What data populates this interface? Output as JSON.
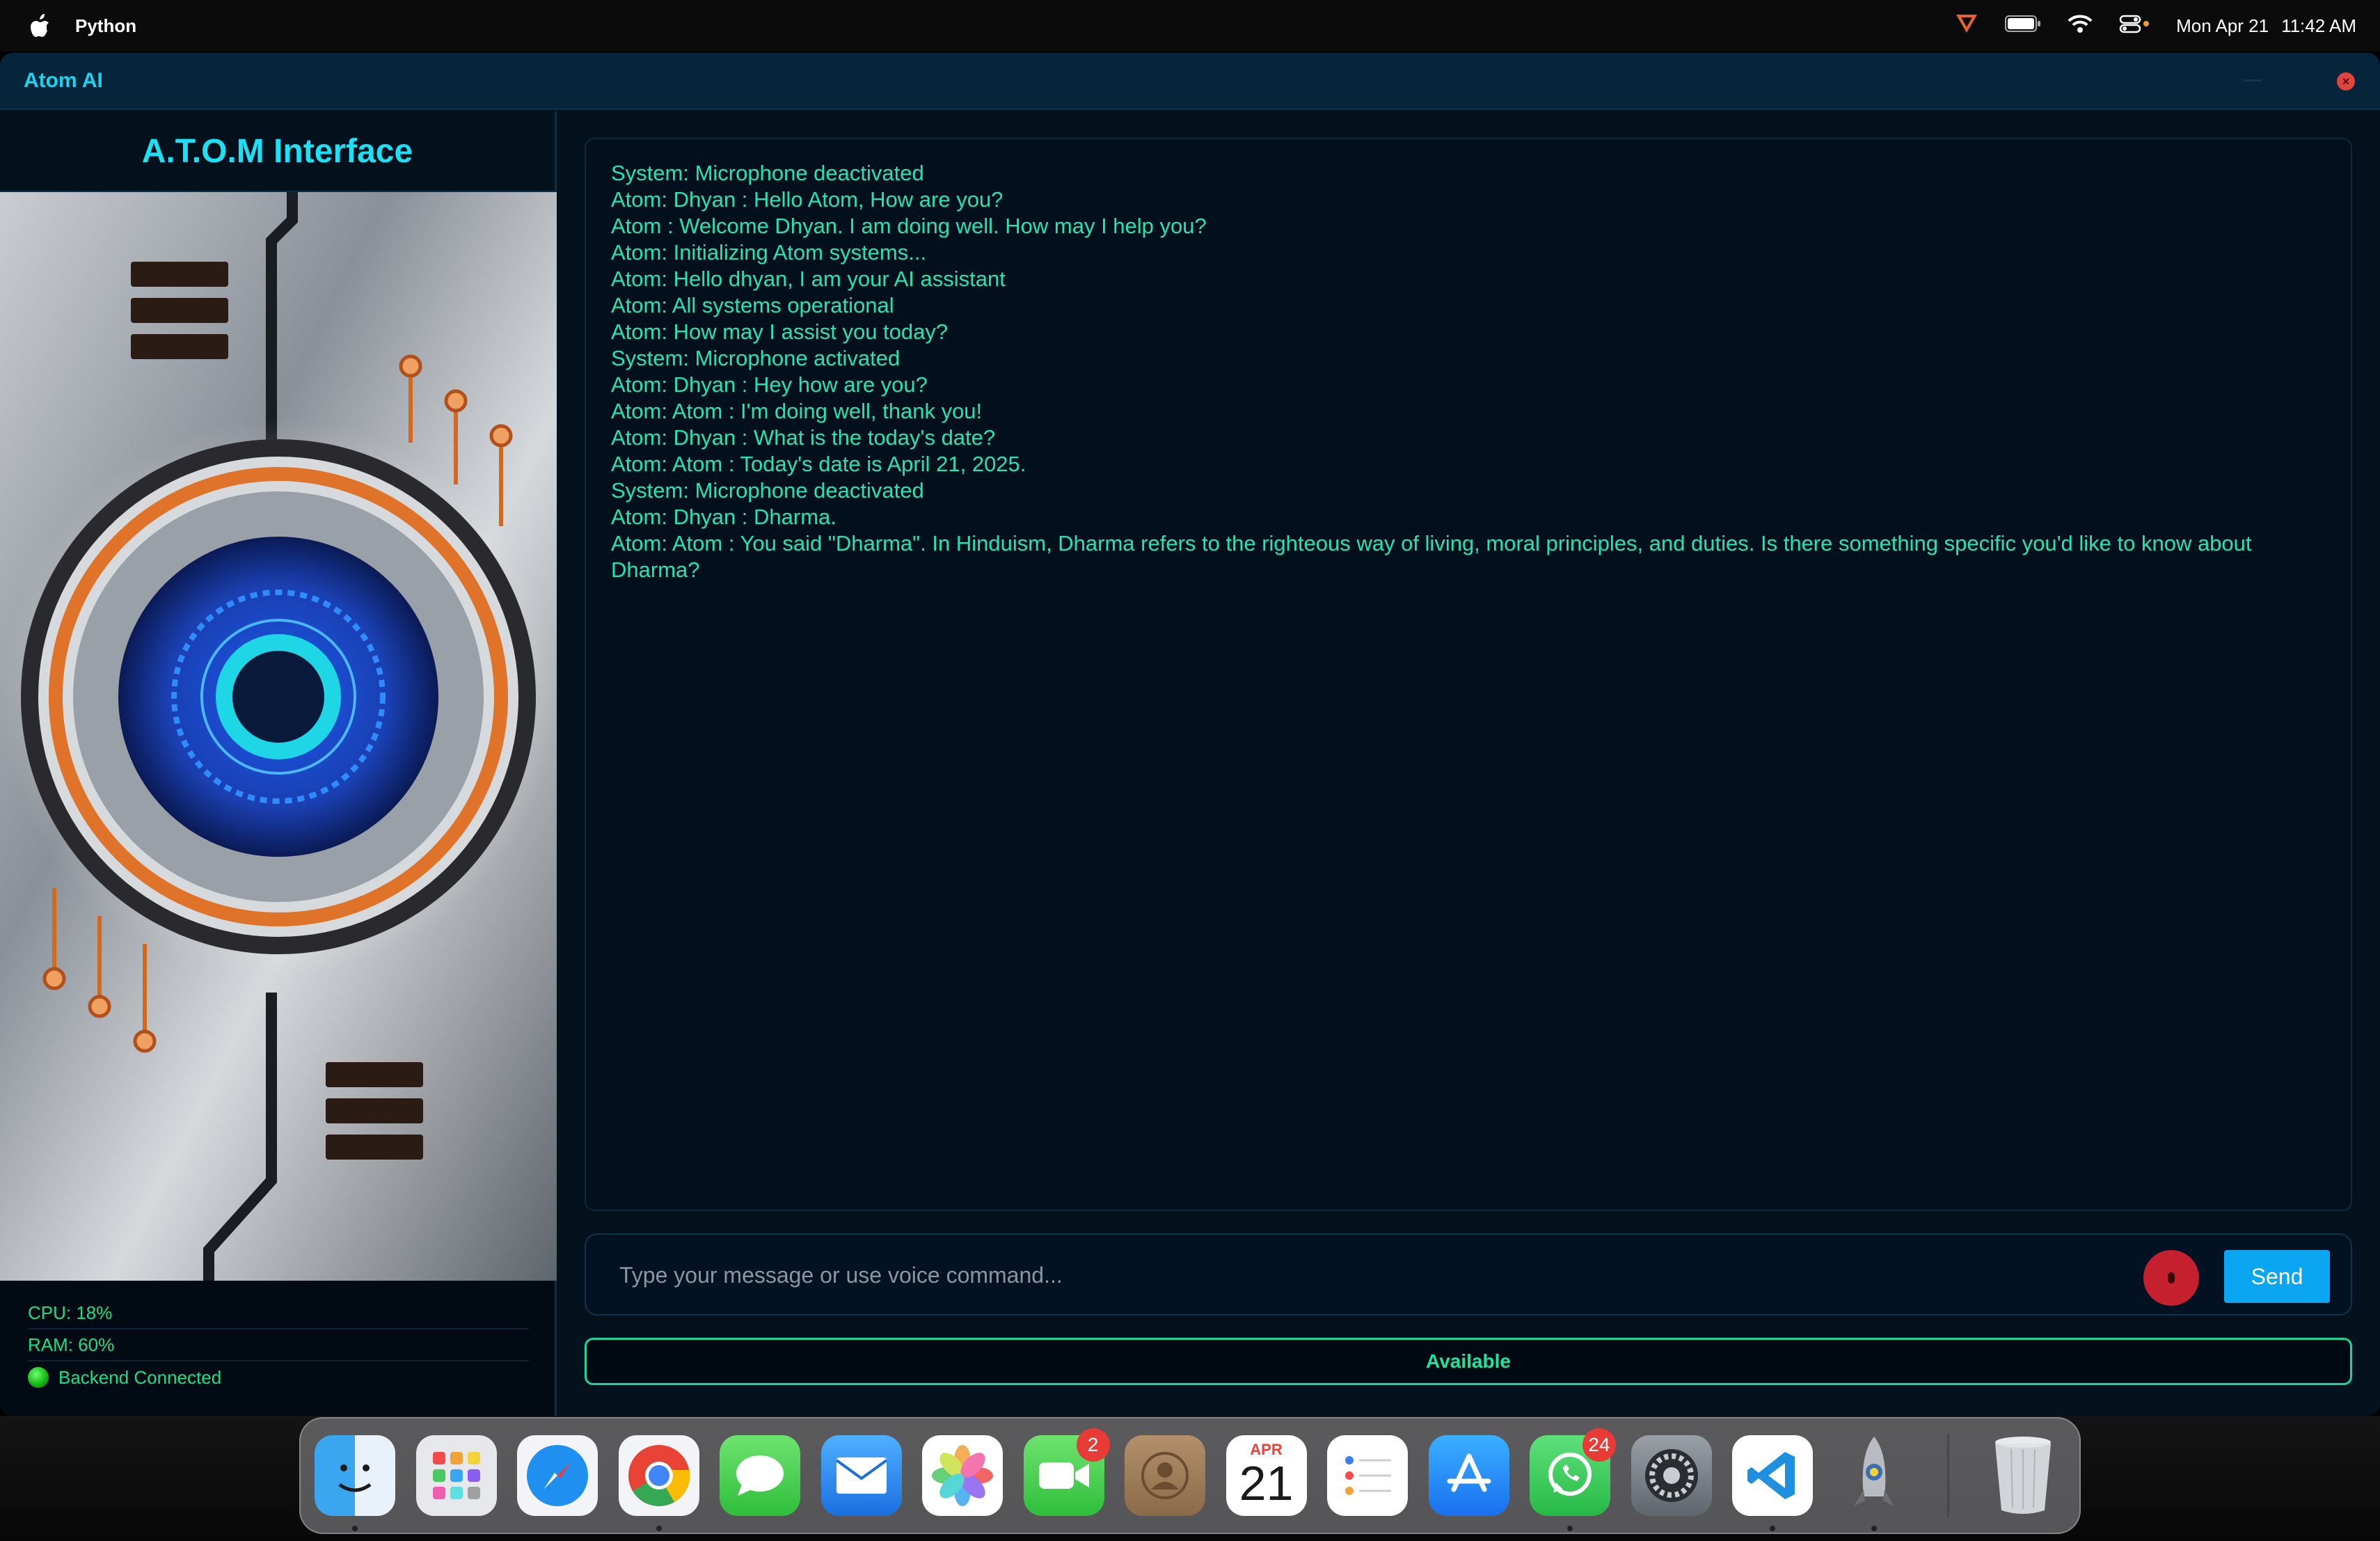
{
  "menubar": {
    "app_name": "Python",
    "date": "Mon Apr 21",
    "time": "11:42 AM"
  },
  "window": {
    "title": "Atom AI"
  },
  "left_panel": {
    "heading": "A.T.O.M Interface",
    "cpu": "CPU: 18%",
    "ram": "RAM: 60%",
    "backend_status": "Backend Connected"
  },
  "chat": {
    "messages": [
      "System: Microphone deactivated",
      "Atom: Dhyan : Hello Atom, How are you?",
      "Atom : Welcome Dhyan. I am doing well. How may I help you?",
      "Atom: Initializing Atom systems...",
      "Atom: Hello dhyan, I am your AI assistant",
      "Atom: All systems operational",
      "Atom: How may I assist you today?",
      "System: Microphone activated",
      "Atom: Dhyan : Hey how are you?",
      "Atom: Atom : I'm doing well, thank you!",
      "Atom: Dhyan : What is the today's date?",
      "Atom: Atom : Today's date is April 21, 2025.",
      "System: Microphone deactivated",
      "Atom: Dhyan : Dharma.",
      "Atom: Atom : You said \"Dharma\". In Hinduism, Dharma refers to the righteous way of living, moral principles, and duties. Is there something specific you'd like to know about Dharma?"
    ]
  },
  "input": {
    "placeholder": "Type your message or use voice command...",
    "send_label": "Send"
  },
  "status_bar": {
    "text": "Available"
  },
  "dock": {
    "apps": [
      {
        "name": "Finder",
        "icon": "finder-icon"
      },
      {
        "name": "Launchpad",
        "icon": "launchpad-icon"
      },
      {
        "name": "Safari",
        "icon": "safari-icon"
      },
      {
        "name": "Chrome",
        "icon": "chrome-icon"
      },
      {
        "name": "Messages",
        "icon": "messages-icon"
      },
      {
        "name": "Mail",
        "icon": "mail-icon"
      },
      {
        "name": "Photos",
        "icon": "photos-icon"
      },
      {
        "name": "FaceTime",
        "icon": "facetime-icon",
        "badge": "2"
      },
      {
        "name": "Contacts",
        "icon": "contacts-icon"
      },
      {
        "name": "Calendar",
        "icon": "calendar-icon",
        "month": "APR",
        "day": "21"
      },
      {
        "name": "Reminders",
        "icon": "reminders-icon"
      },
      {
        "name": "App Store",
        "icon": "app-store-icon"
      },
      {
        "name": "WhatsApp",
        "icon": "whatsapp-icon",
        "badge": "24"
      },
      {
        "name": "System Settings",
        "icon": "settings-icon"
      },
      {
        "name": "VS Code",
        "icon": "vscode-icon"
      },
      {
        "name": "Python Launcher",
        "icon": "python-rocket-icon"
      },
      {
        "name": "Trash",
        "icon": "trash-icon"
      }
    ]
  },
  "colors": {
    "accent_cyan": "#1ee0f5",
    "chat_text": "#21e6b3",
    "send_button": "#0aa6f2",
    "mic_button": "#c5202e",
    "status_border": "#17d69a"
  }
}
